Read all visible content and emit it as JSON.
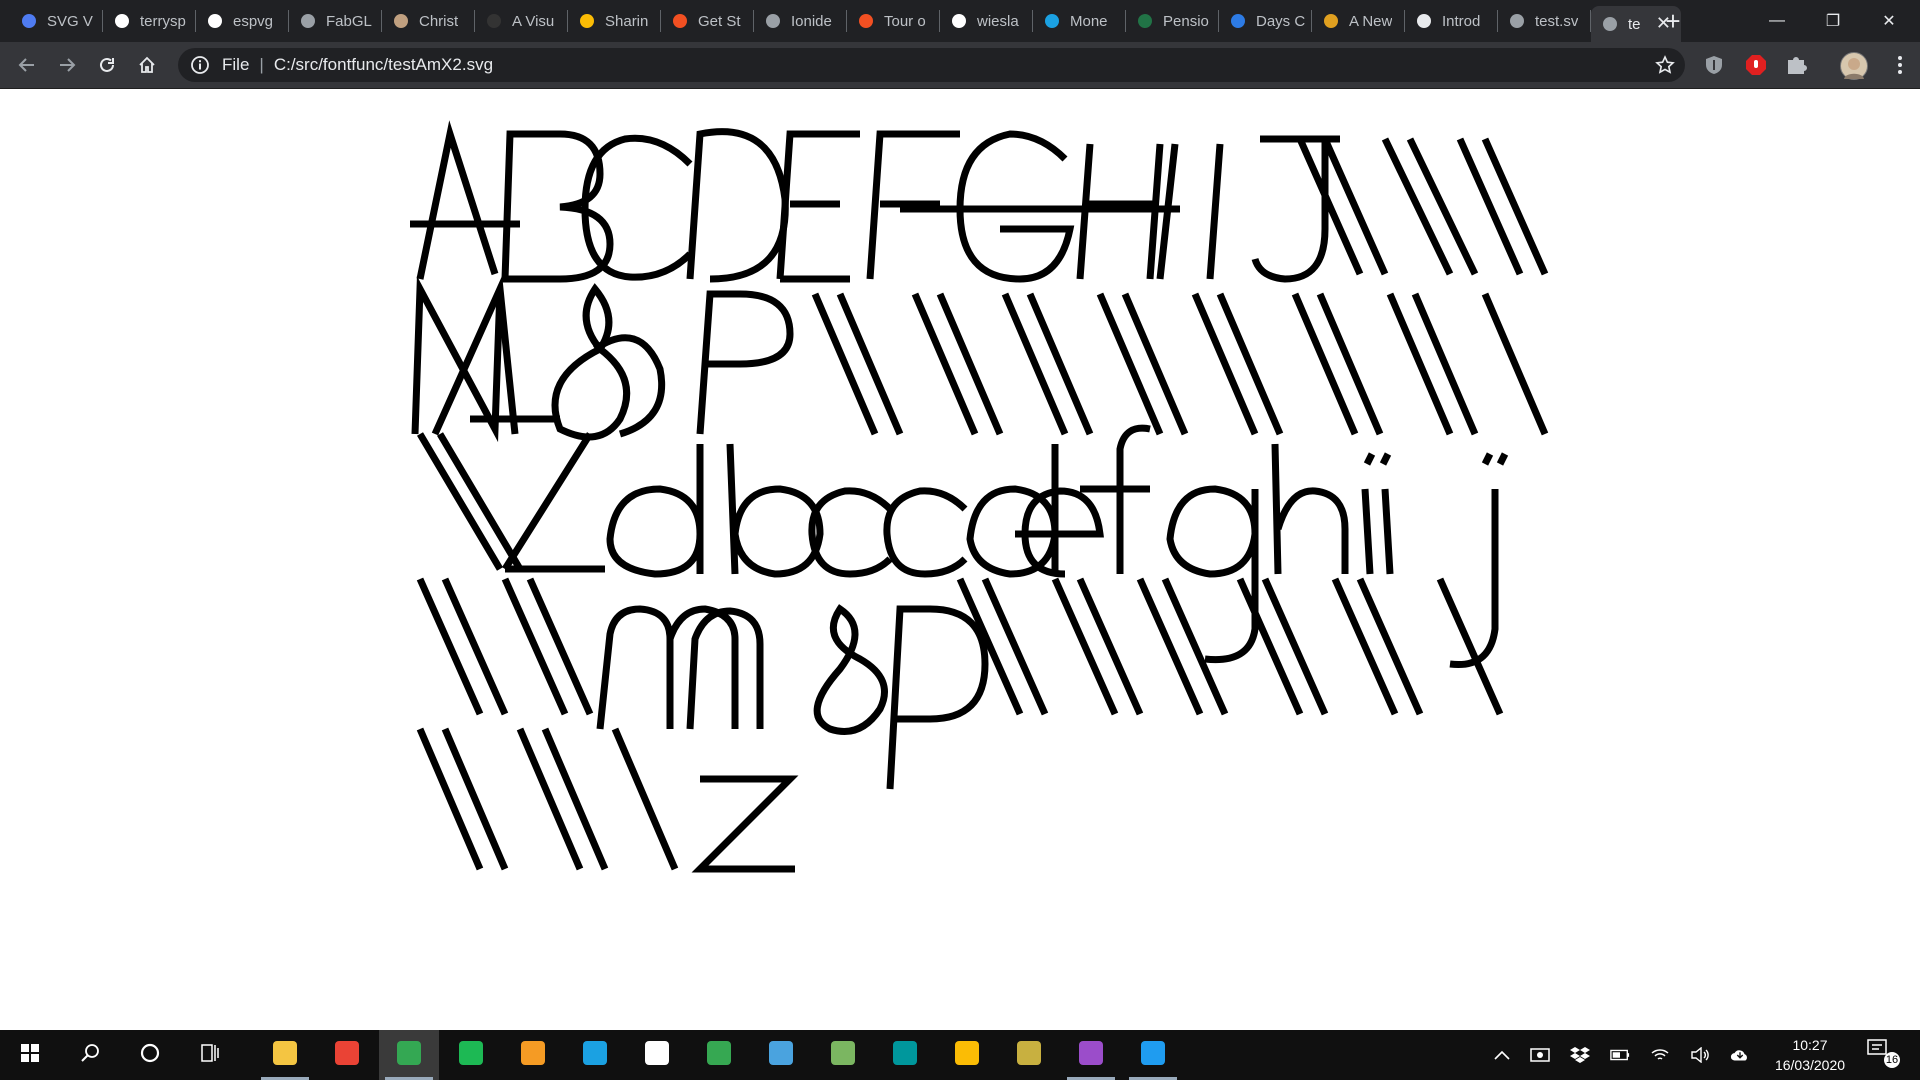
{
  "browser": {
    "tabs": [
      {
        "title": "SVG V",
        "icon": "svg-viewer-icon",
        "color": "#4f7cf2"
      },
      {
        "title": "terrysp",
        "icon": "github-icon",
        "color": "#ffffff"
      },
      {
        "title": "espvg",
        "icon": "github-icon",
        "color": "#ffffff"
      },
      {
        "title": "FabGL",
        "icon": "globe-icon",
        "color": "#9aa0a6"
      },
      {
        "title": "Christ",
        "icon": "image-icon",
        "color": "#c0a080"
      },
      {
        "title": "A Visu",
        "icon": "dark-circle-icon",
        "color": "#333333"
      },
      {
        "title": "Sharin",
        "icon": "google-photos-icon",
        "color": "#fbbc05"
      },
      {
        "title": "Get St",
        "icon": "microsoft-icon",
        "color": "#f25022"
      },
      {
        "title": "Ionide",
        "icon": "globe-icon",
        "color": "#9aa0a6"
      },
      {
        "title": "Tour o",
        "icon": "microsoft-icon",
        "color": "#f25022"
      },
      {
        "title": "wiesla",
        "icon": "github-icon",
        "color": "#ffffff"
      },
      {
        "title": "Mone",
        "icon": "money-icon",
        "color": "#1ba1e2"
      },
      {
        "title": "Pensio",
        "icon": "excel-icon",
        "color": "#217346"
      },
      {
        "title": "Days C",
        "icon": "diamond-icon",
        "color": "#2d7be5"
      },
      {
        "title": "A New",
        "icon": "sun-icon",
        "color": "#e0a020"
      },
      {
        "title": "Introd",
        "icon": "mortarboard-icon",
        "color": "#e8eaed"
      },
      {
        "title": "test.sv",
        "icon": "globe-icon",
        "color": "#9aa0a6"
      },
      {
        "title": "te",
        "icon": "globe-icon",
        "color": "#9aa0a6",
        "active": true
      }
    ],
    "new_tab_symbol": "+",
    "window_controls": {
      "minimize": "—",
      "restore": "❐",
      "close": "✕"
    },
    "omnibox": {
      "scheme": "File",
      "separator": "|",
      "url": "C:/src/fontfunc/testAmX2.svg"
    }
  },
  "page": {
    "description_glyph_rows": [
      "ABCDEFGHIJ",
      "MNOP",
      "Zabcdefghij",
      "mnop",
      "z"
    ],
    "stroke_color": "#000000"
  },
  "taskbar": {
    "apps": [
      {
        "name": "start-button",
        "icon": "windows-icon"
      },
      {
        "name": "search-button",
        "icon": "search-icon"
      },
      {
        "name": "cortana-button",
        "icon": "circle-icon"
      },
      {
        "name": "task-view-button",
        "icon": "task-view-icon"
      },
      {
        "name": "file-explorer",
        "icon": "folder-icon",
        "running": true
      },
      {
        "name": "gmail",
        "icon": "mail-icon"
      },
      {
        "name": "chrome",
        "icon": "chrome-icon",
        "running": true,
        "active": true
      },
      {
        "name": "spotify",
        "icon": "spotify-icon"
      },
      {
        "name": "fusion",
        "icon": "f-app-icon"
      },
      {
        "name": "c-app",
        "icon": "c-app-icon"
      },
      {
        "name": "notepad",
        "icon": "document-icon"
      },
      {
        "name": "x-app",
        "icon": "x-app-icon"
      },
      {
        "name": "e-app",
        "icon": "terminal-icon"
      },
      {
        "name": "photos-app",
        "icon": "image-icon"
      },
      {
        "name": "arduino",
        "icon": "arduino-icon"
      },
      {
        "name": "keep",
        "icon": "lightbulb-icon"
      },
      {
        "name": "globe-app",
        "icon": "globe-icon"
      },
      {
        "name": "visual-studio",
        "icon": "visual-studio-icon",
        "running": true
      },
      {
        "name": "vscode",
        "icon": "vscode-icon",
        "running": true
      }
    ],
    "clock": {
      "time": "10:27",
      "date": "16/03/2020"
    },
    "notifications_count": "16"
  }
}
